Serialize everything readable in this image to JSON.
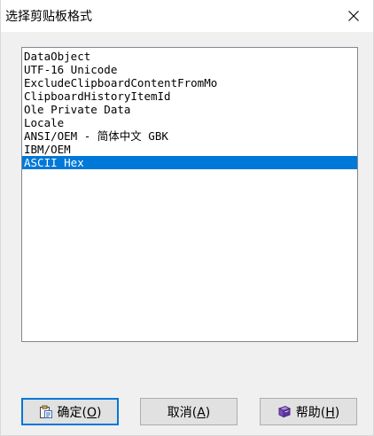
{
  "window": {
    "title": "选择剪贴板格式"
  },
  "list": {
    "items": [
      {
        "label": "DataObject"
      },
      {
        "label": "UTF-16 Unicode"
      },
      {
        "label": "ExcludeClipboardContentFromMo"
      },
      {
        "label": "ClipboardHistoryItemId"
      },
      {
        "label": "Ole Private Data"
      },
      {
        "label": "Locale"
      },
      {
        "label": "ANSI/OEM - 简体中文 GBK"
      },
      {
        "label": "IBM/OEM"
      },
      {
        "label": "ASCII Hex"
      }
    ],
    "selected_index": 8
  },
  "buttons": {
    "ok": {
      "label": "确定(",
      "mnemonic": "O",
      "suffix": ")",
      "icon": "clipboard-icon"
    },
    "cancel": {
      "label": "取消(",
      "mnemonic": "A",
      "suffix": ")"
    },
    "help": {
      "label": "帮助(",
      "mnemonic": "H",
      "suffix": ")",
      "icon": "help-book-icon"
    }
  },
  "colors": {
    "selection": "#0078d7",
    "button_face": "#e1e1e1",
    "dialog_bg": "#f0f0f0"
  }
}
